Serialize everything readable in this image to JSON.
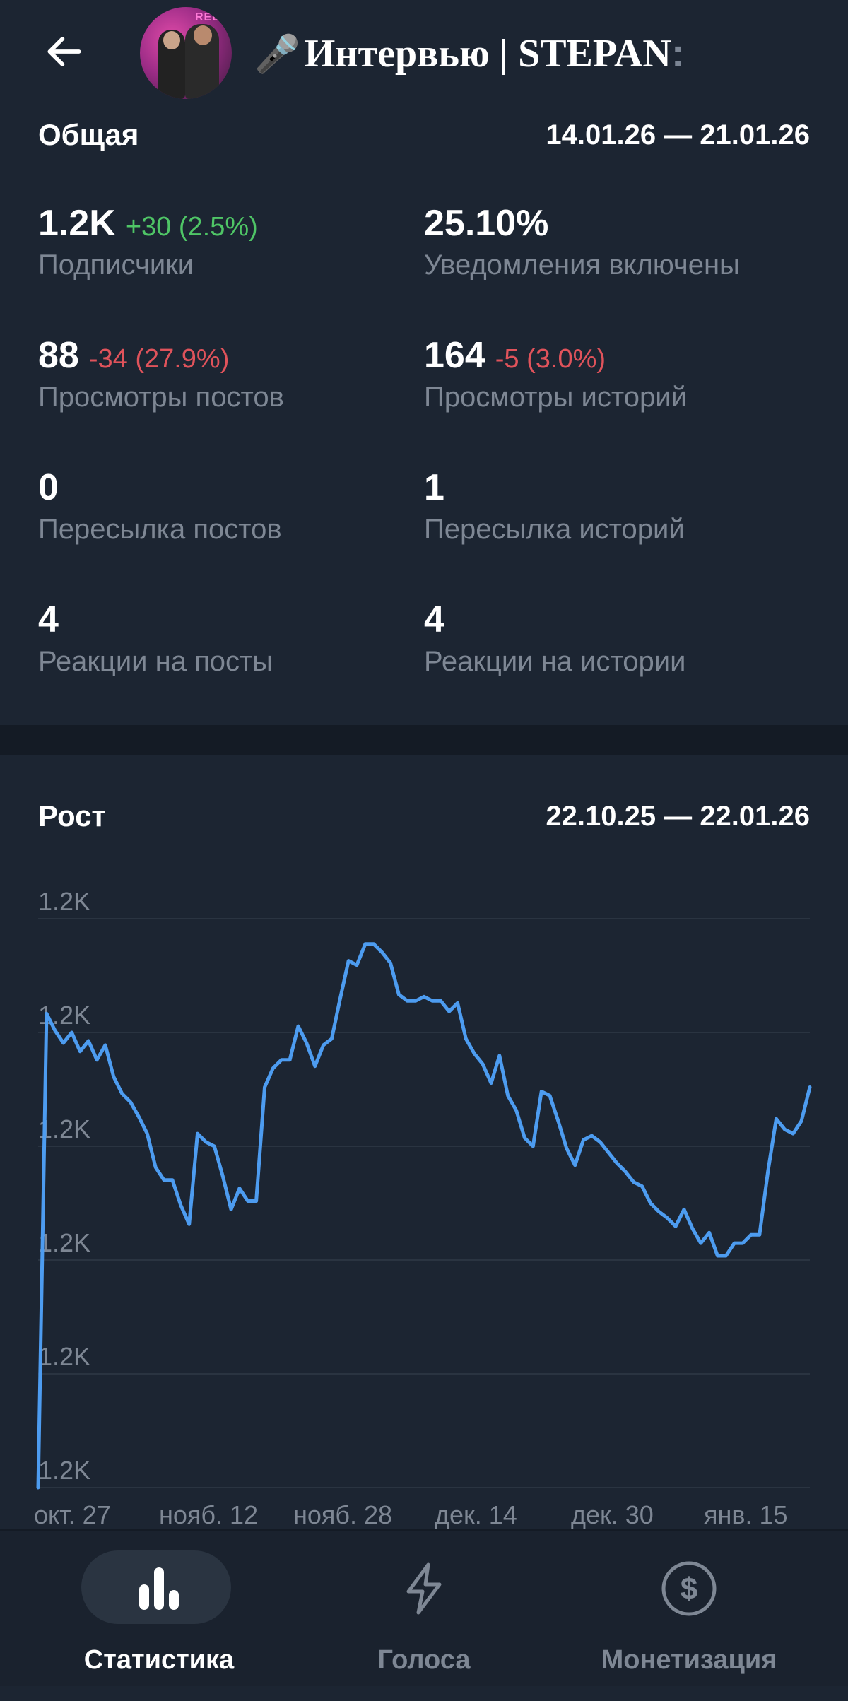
{
  "header": {
    "title": "Интервью | STEPAN",
    "title_suffix": ":",
    "avatar_text": "REEL"
  },
  "overview": {
    "title": "Общая",
    "date_range": "14.01.26 — 21.01.26",
    "stats": [
      {
        "value": "1.2K",
        "delta": "+30 (2.5%)",
        "delta_type": "positive",
        "label": "Подписчики"
      },
      {
        "value": "25.10%",
        "delta": "",
        "delta_type": "none",
        "label": "Уведомления включены"
      },
      {
        "value": "88",
        "delta": "-34 (27.9%)",
        "delta_type": "negative",
        "label": "Просмотры постов"
      },
      {
        "value": "164",
        "delta": "-5 (3.0%)",
        "delta_type": "negative",
        "label": "Просмотры историй"
      },
      {
        "value": "0",
        "delta": "",
        "delta_type": "none",
        "label": "Пересылка постов"
      },
      {
        "value": "1",
        "delta": "",
        "delta_type": "none",
        "label": "Пересылка историй"
      },
      {
        "value": "4",
        "delta": "",
        "delta_type": "none",
        "label": "Реакции на посты"
      },
      {
        "value": "4",
        "delta": "",
        "delta_type": "none",
        "label": "Реакции на истории"
      }
    ]
  },
  "growth": {
    "title": "Рост",
    "date_range": "22.10.25 — 22.01.26"
  },
  "chart_data": {
    "type": "line",
    "title": "Рост",
    "y_tick_labels": [
      "1.2K",
      "1.2K",
      "1.2K",
      "1.2K",
      "1.2K",
      "1.2K"
    ],
    "x_tick_labels": [
      "окт. 27",
      "нояб. 12",
      "нояб. 28",
      "дек. 14",
      "дек. 30",
      "янв. 15"
    ],
    "ylim": [
      1185,
      1212
    ],
    "grid": true,
    "line_color": "#4d9cf0",
    "series": [
      {
        "values": [
          1185,
          1207.5,
          1206.7,
          1206.1,
          1206.6,
          1205.7,
          1206.2,
          1205.3,
          1206.0,
          1204.5,
          1203.7,
          1203.3,
          1202.6,
          1201.8,
          1200.2,
          1199.6,
          1199.6,
          1198.4,
          1197.5,
          1201.8,
          1201.4,
          1201.2,
          1199.8,
          1198.2,
          1199.2,
          1198.6,
          1198.6,
          1204.0,
          1204.9,
          1205.3,
          1205.3,
          1206.9,
          1206.1,
          1205.0,
          1206.0,
          1206.3,
          1208.2,
          1210.0,
          1209.8,
          1210.8,
          1210.8,
          1210.4,
          1209.9,
          1208.4,
          1208.1,
          1208.1,
          1208.3,
          1208.1,
          1208.1,
          1207.6,
          1208.0,
          1206.3,
          1205.6,
          1205.1,
          1204.2,
          1205.5,
          1203.6,
          1202.9,
          1201.6,
          1201.2,
          1203.8,
          1203.6,
          1202.4,
          1201.1,
          1200.3,
          1201.5,
          1201.7,
          1201.4,
          1200.9,
          1200.4,
          1200.0,
          1199.5,
          1199.3,
          1198.5,
          1198.1,
          1197.8,
          1197.4,
          1198.2,
          1197.3,
          1196.6,
          1197.1,
          1196.0,
          1196.0,
          1196.6,
          1196.6,
          1197.0,
          1197.0,
          1200.0,
          1202.5,
          1202.0,
          1201.8,
          1202.4,
          1204.0
        ]
      }
    ]
  },
  "bottom_nav": {
    "items": [
      {
        "label": "Статистика",
        "active": true
      },
      {
        "label": "Голоса",
        "active": false
      },
      {
        "label": "Монетизация",
        "active": false
      }
    ]
  }
}
